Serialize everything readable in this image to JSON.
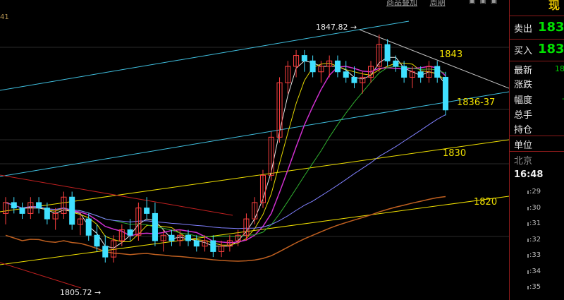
{
  "top_menu": {
    "item1": "商品叠加",
    "item2": "周期"
  },
  "edge_label": "41",
  "annotations": {
    "high_label": "1847.82",
    "low_label": "1805.72",
    "level_1843": "1843",
    "level_1836": "1836-37",
    "level_1830": "1830",
    "level_1820": "1820"
  },
  "side_panel": {
    "title": "现",
    "sell_label": "卖出",
    "sell_value": "183",
    "buy_label": "买入",
    "buy_value": "183",
    "latest_label": "最新",
    "latest_value": "18",
    "change_label": "涨跌",
    "amplitude_label": "幅度",
    "amplitude_value": "-",
    "volume_label": "总手",
    "position_label": "持仓",
    "unit_label": "单位",
    "city_label": "北京",
    "time": "16:48",
    "ticks": [
      ":29",
      ":30",
      ":31",
      ":32",
      ":33",
      ":34",
      ":35"
    ]
  },
  "colors": {
    "up": "#ff4040",
    "down": "#40e0ff",
    "ma_white": "#e8e8e8",
    "ma_yellow": "#e6d800",
    "ma_magenta": "#d030d0",
    "ma_green": "#30b030",
    "ma_purple": "#8080ff",
    "ma_orange": "#c06020",
    "channel_cyan": "#40c0e0",
    "trend_yellow": "#f0e000",
    "trend_red": "#c02020",
    "resist_gray": "#c0c0c0"
  },
  "chart_data": {
    "type": "candlestick",
    "annotated_high": 1847.82,
    "annotated_low": 1805.72,
    "marked_levels": [
      1843,
      1836.5,
      1830,
      1820
    ],
    "ohlc": [
      [
        1815,
        1818,
        1813,
        1817
      ],
      [
        1817,
        1818,
        1815,
        1816
      ],
      [
        1816,
        1817,
        1814,
        1815
      ],
      [
        1815,
        1818,
        1814,
        1817
      ],
      [
        1817,
        1818,
        1815,
        1816
      ],
      [
        1816,
        1817,
        1813,
        1814
      ],
      [
        1814,
        1816,
        1812,
        1815
      ],
      [
        1815,
        1819,
        1814,
        1818
      ],
      [
        1818,
        1819,
        1812,
        1813
      ],
      [
        1813,
        1815,
        1811,
        1814
      ],
      [
        1814,
        1815,
        1810,
        1811
      ],
      [
        1811,
        1813,
        1808,
        1809
      ],
      [
        1809,
        1811,
        1806,
        1807
      ],
      [
        1807,
        1811,
        1806,
        1810
      ],
      [
        1810,
        1813,
        1809,
        1812
      ],
      [
        1812,
        1814,
        1810,
        1811
      ],
      [
        1811,
        1817,
        1810,
        1816
      ],
      [
        1816,
        1818,
        1814,
        1815
      ],
      [
        1815,
        1817,
        1809,
        1810
      ],
      [
        1810,
        1812,
        1808,
        1811
      ],
      [
        1811,
        1812,
        1809,
        1810
      ],
      [
        1810,
        1812,
        1809,
        1811
      ],
      [
        1811,
        1812,
        1809,
        1810
      ],
      [
        1810,
        1811,
        1808,
        1809
      ],
      [
        1809,
        1811,
        1808,
        1810
      ],
      [
        1810,
        1811,
        1807,
        1808
      ],
      [
        1808,
        1810,
        1807,
        1809
      ],
      [
        1809,
        1811,
        1808,
        1810
      ],
      [
        1810,
        1812,
        1809,
        1811
      ],
      [
        1811,
        1815,
        1810,
        1814
      ],
      [
        1814,
        1818,
        1813,
        1817
      ],
      [
        1817,
        1823,
        1816,
        1822
      ],
      [
        1822,
        1830,
        1821,
        1829
      ],
      [
        1829,
        1840,
        1828,
        1839
      ],
      [
        1839,
        1843,
        1837,
        1842
      ],
      [
        1842,
        1845,
        1840,
        1844
      ],
      [
        1844,
        1845,
        1841,
        1843
      ],
      [
        1843,
        1844,
        1840,
        1841
      ],
      [
        1841,
        1843,
        1839,
        1842
      ],
      [
        1842,
        1844,
        1840,
        1843
      ],
      [
        1843,
        1844,
        1840,
        1841
      ],
      [
        1841,
        1843,
        1839,
        1840
      ],
      [
        1840,
        1842,
        1838,
        1839
      ],
      [
        1839,
        1841,
        1837,
        1840
      ],
      [
        1840,
        1843,
        1839,
        1842
      ],
      [
        1842,
        1847.82,
        1841,
        1846
      ],
      [
        1846,
        1847,
        1842,
        1843
      ],
      [
        1843,
        1844,
        1841,
        1842
      ],
      [
        1842,
        1843,
        1839,
        1840
      ],
      [
        1840,
        1842,
        1838,
        1841
      ],
      [
        1841,
        1842,
        1839,
        1840
      ],
      [
        1840,
        1843,
        1839,
        1842
      ],
      [
        1842,
        1843,
        1839,
        1840
      ],
      [
        1840,
        1841,
        1833,
        1834
      ]
    ]
  }
}
